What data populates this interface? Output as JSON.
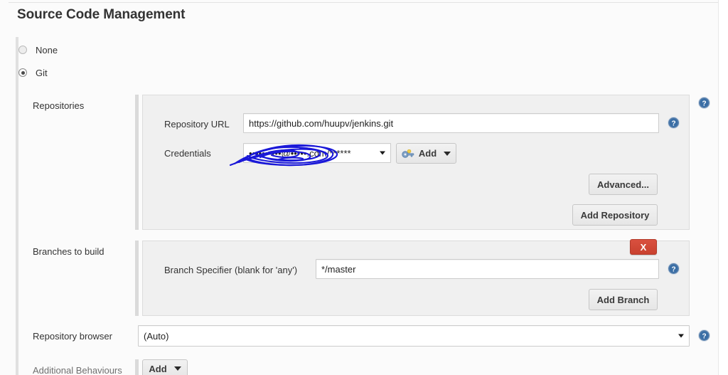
{
  "page": {
    "section_title": "Source Code Management"
  },
  "scm_type": {
    "options": [
      {
        "label": "None",
        "selected": false,
        "name": "radio-none"
      },
      {
        "label": "Git",
        "selected": true,
        "name": "radio-git"
      }
    ]
  },
  "rows": {
    "repositories_label": "Repositories",
    "branches_label": "Branches to build",
    "repository_browser_label": "Repository browser",
    "additional_behaviours_label": "Additional Behaviours"
  },
  "repositories": {
    "url_label": "Repository URL",
    "url_value": "https://github.com/huupv/jenkins.git",
    "url_placeholder": "",
    "credentials_label": "Credentials",
    "credentials_value": "••••••••••@•••••.com/******",
    "credentials_redacted": true,
    "add_credentials_label": "Add",
    "advanced_label": "Advanced...",
    "add_repository_label": "Add Repository"
  },
  "branches": {
    "specifier_label": "Branch Specifier (blank for 'any')",
    "specifier_value": "*/master",
    "delete_label": "X",
    "add_branch_label": "Add Branch"
  },
  "repository_browser": {
    "value": "(Auto)"
  },
  "additional_behaviours": {
    "add_label": "Add"
  },
  "icons": {
    "help": "help-icon",
    "key": "key-icon",
    "caret_down": "chevron-down-icon"
  },
  "colors": {
    "page_bg": "#fbfbfb",
    "panel_bg": "#f0f0f0",
    "panel_border": "#dcdcdc",
    "input_border": "#cccccc",
    "text": "#333333",
    "help_blue": "#3a6ea5",
    "delete_red": "#c9412f",
    "scribble_blue": "#1a18d8"
  }
}
